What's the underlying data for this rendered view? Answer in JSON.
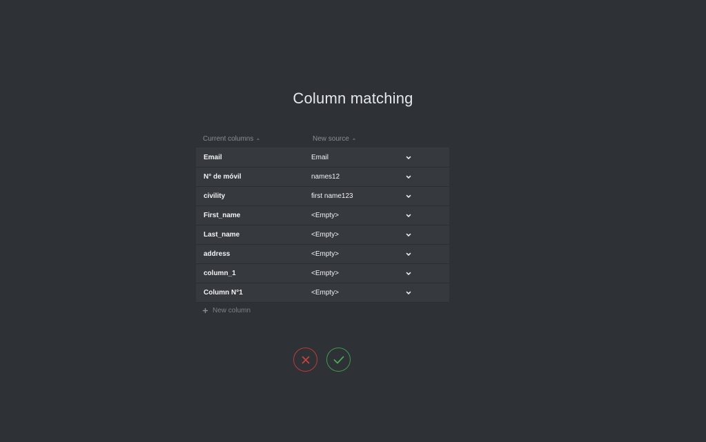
{
  "title": "Column matching",
  "table": {
    "headers": {
      "current": "Current columns",
      "new": "New source"
    },
    "rows": [
      {
        "current": "Email",
        "source": "Email"
      },
      {
        "current": "N° de móvil",
        "source": "names12"
      },
      {
        "current": "civility",
        "source": "first name123"
      },
      {
        "current": "First_name",
        "source": "<Empty>"
      },
      {
        "current": "Last_name",
        "source": "<Empty>"
      },
      {
        "current": "address",
        "source": "<Empty>"
      },
      {
        "current": "column_1",
        "source": "<Empty>"
      },
      {
        "current": "Column N°1",
        "source": "<Empty>"
      }
    ],
    "new_column_label": "New column"
  },
  "icons": {
    "sort": "sort-up-icon",
    "dropdown": "chevron-down-icon",
    "add": "plus-icon",
    "cancel": "close-icon",
    "confirm": "check-icon"
  },
  "colors": {
    "background": "#2e3236",
    "row": "#363a3f",
    "cancel": "#c33a36",
    "confirm": "#3f9f4a"
  }
}
